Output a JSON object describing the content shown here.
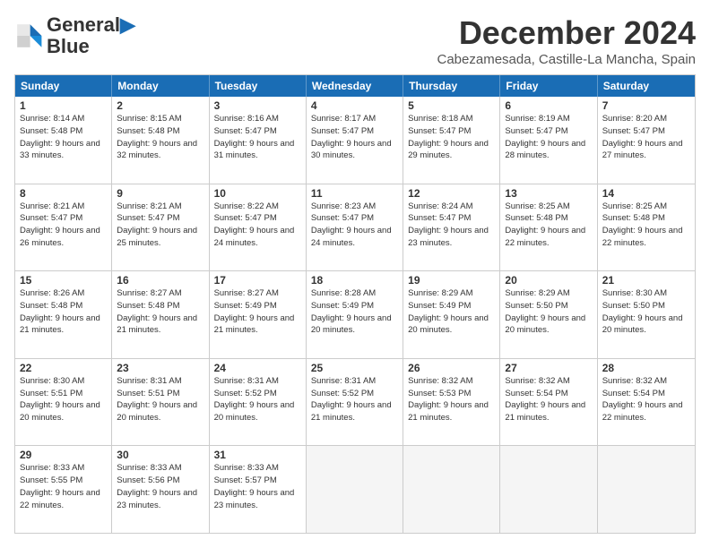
{
  "header": {
    "logo_line1": "General",
    "logo_line2": "Blue",
    "month": "December 2024",
    "location": "Cabezamesada, Castille-La Mancha, Spain"
  },
  "days_of_week": [
    "Sunday",
    "Monday",
    "Tuesday",
    "Wednesday",
    "Thursday",
    "Friday",
    "Saturday"
  ],
  "weeks": [
    [
      {
        "day": "1",
        "sunrise": "Sunrise: 8:14 AM",
        "sunset": "Sunset: 5:48 PM",
        "daylight": "Daylight: 9 hours and 33 minutes."
      },
      {
        "day": "2",
        "sunrise": "Sunrise: 8:15 AM",
        "sunset": "Sunset: 5:48 PM",
        "daylight": "Daylight: 9 hours and 32 minutes."
      },
      {
        "day": "3",
        "sunrise": "Sunrise: 8:16 AM",
        "sunset": "Sunset: 5:47 PM",
        "daylight": "Daylight: 9 hours and 31 minutes."
      },
      {
        "day": "4",
        "sunrise": "Sunrise: 8:17 AM",
        "sunset": "Sunset: 5:47 PM",
        "daylight": "Daylight: 9 hours and 30 minutes."
      },
      {
        "day": "5",
        "sunrise": "Sunrise: 8:18 AM",
        "sunset": "Sunset: 5:47 PM",
        "daylight": "Daylight: 9 hours and 29 minutes."
      },
      {
        "day": "6",
        "sunrise": "Sunrise: 8:19 AM",
        "sunset": "Sunset: 5:47 PM",
        "daylight": "Daylight: 9 hours and 28 minutes."
      },
      {
        "day": "7",
        "sunrise": "Sunrise: 8:20 AM",
        "sunset": "Sunset: 5:47 PM",
        "daylight": "Daylight: 9 hours and 27 minutes."
      }
    ],
    [
      {
        "day": "8",
        "sunrise": "Sunrise: 8:21 AM",
        "sunset": "Sunset: 5:47 PM",
        "daylight": "Daylight: 9 hours and 26 minutes."
      },
      {
        "day": "9",
        "sunrise": "Sunrise: 8:21 AM",
        "sunset": "Sunset: 5:47 PM",
        "daylight": "Daylight: 9 hours and 25 minutes."
      },
      {
        "day": "10",
        "sunrise": "Sunrise: 8:22 AM",
        "sunset": "Sunset: 5:47 PM",
        "daylight": "Daylight: 9 hours and 24 minutes."
      },
      {
        "day": "11",
        "sunrise": "Sunrise: 8:23 AM",
        "sunset": "Sunset: 5:47 PM",
        "daylight": "Daylight: 9 hours and 24 minutes."
      },
      {
        "day": "12",
        "sunrise": "Sunrise: 8:24 AM",
        "sunset": "Sunset: 5:47 PM",
        "daylight": "Daylight: 9 hours and 23 minutes."
      },
      {
        "day": "13",
        "sunrise": "Sunrise: 8:25 AM",
        "sunset": "Sunset: 5:48 PM",
        "daylight": "Daylight: 9 hours and 22 minutes."
      },
      {
        "day": "14",
        "sunrise": "Sunrise: 8:25 AM",
        "sunset": "Sunset: 5:48 PM",
        "daylight": "Daylight: 9 hours and 22 minutes."
      }
    ],
    [
      {
        "day": "15",
        "sunrise": "Sunrise: 8:26 AM",
        "sunset": "Sunset: 5:48 PM",
        "daylight": "Daylight: 9 hours and 21 minutes."
      },
      {
        "day": "16",
        "sunrise": "Sunrise: 8:27 AM",
        "sunset": "Sunset: 5:48 PM",
        "daylight": "Daylight: 9 hours and 21 minutes."
      },
      {
        "day": "17",
        "sunrise": "Sunrise: 8:27 AM",
        "sunset": "Sunset: 5:49 PM",
        "daylight": "Daylight: 9 hours and 21 minutes."
      },
      {
        "day": "18",
        "sunrise": "Sunrise: 8:28 AM",
        "sunset": "Sunset: 5:49 PM",
        "daylight": "Daylight: 9 hours and 20 minutes."
      },
      {
        "day": "19",
        "sunrise": "Sunrise: 8:29 AM",
        "sunset": "Sunset: 5:49 PM",
        "daylight": "Daylight: 9 hours and 20 minutes."
      },
      {
        "day": "20",
        "sunrise": "Sunrise: 8:29 AM",
        "sunset": "Sunset: 5:50 PM",
        "daylight": "Daylight: 9 hours and 20 minutes."
      },
      {
        "day": "21",
        "sunrise": "Sunrise: 8:30 AM",
        "sunset": "Sunset: 5:50 PM",
        "daylight": "Daylight: 9 hours and 20 minutes."
      }
    ],
    [
      {
        "day": "22",
        "sunrise": "Sunrise: 8:30 AM",
        "sunset": "Sunset: 5:51 PM",
        "daylight": "Daylight: 9 hours and 20 minutes."
      },
      {
        "day": "23",
        "sunrise": "Sunrise: 8:31 AM",
        "sunset": "Sunset: 5:51 PM",
        "daylight": "Daylight: 9 hours and 20 minutes."
      },
      {
        "day": "24",
        "sunrise": "Sunrise: 8:31 AM",
        "sunset": "Sunset: 5:52 PM",
        "daylight": "Daylight: 9 hours and 20 minutes."
      },
      {
        "day": "25",
        "sunrise": "Sunrise: 8:31 AM",
        "sunset": "Sunset: 5:52 PM",
        "daylight": "Daylight: 9 hours and 21 minutes."
      },
      {
        "day": "26",
        "sunrise": "Sunrise: 8:32 AM",
        "sunset": "Sunset: 5:53 PM",
        "daylight": "Daylight: 9 hours and 21 minutes."
      },
      {
        "day": "27",
        "sunrise": "Sunrise: 8:32 AM",
        "sunset": "Sunset: 5:54 PM",
        "daylight": "Daylight: 9 hours and 21 minutes."
      },
      {
        "day": "28",
        "sunrise": "Sunrise: 8:32 AM",
        "sunset": "Sunset: 5:54 PM",
        "daylight": "Daylight: 9 hours and 22 minutes."
      }
    ],
    [
      {
        "day": "29",
        "sunrise": "Sunrise: 8:33 AM",
        "sunset": "Sunset: 5:55 PM",
        "daylight": "Daylight: 9 hours and 22 minutes."
      },
      {
        "day": "30",
        "sunrise": "Sunrise: 8:33 AM",
        "sunset": "Sunset: 5:56 PM",
        "daylight": "Daylight: 9 hours and 23 minutes."
      },
      {
        "day": "31",
        "sunrise": "Sunrise: 8:33 AM",
        "sunset": "Sunset: 5:57 PM",
        "daylight": "Daylight: 9 hours and 23 minutes."
      },
      null,
      null,
      null,
      null
    ]
  ]
}
